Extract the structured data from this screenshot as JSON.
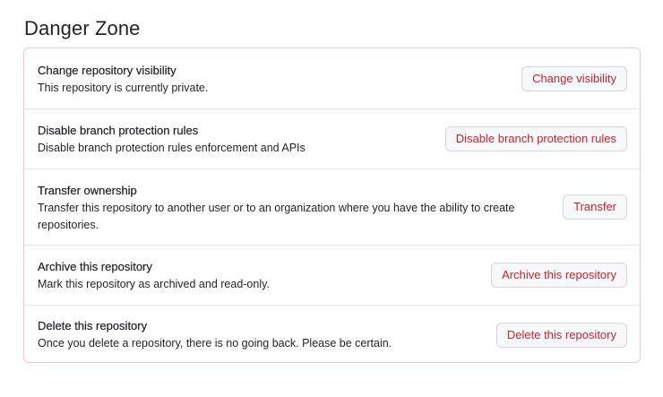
{
  "section": {
    "title": "Danger Zone"
  },
  "rows": [
    {
      "title": "Change repository visibility",
      "description": "This repository is currently private.",
      "button_label": "Change visibility"
    },
    {
      "title": "Disable branch protection rules",
      "description": "Disable branch protection rules enforcement and APIs",
      "button_label": "Disable branch protection rules"
    },
    {
      "title": "Transfer ownership",
      "description_line1": "Transfer this repository to another user or to an organization where you have the ability to create",
      "description_line2": "repositories.",
      "button_label": "Transfer"
    },
    {
      "title": "Archive this repository",
      "description": "Mark this repository as archived and read-only.",
      "button_label": "Archive this repository"
    },
    {
      "title": "Delete this repository",
      "description": "Once you delete a repository, there is no going back. Please be certain.",
      "button_label": "Delete this repository"
    }
  ],
  "colors": {
    "danger_text": "#cf222e",
    "danger_border": "#f2c6cf",
    "button_bg": "#f6f8fa",
    "divider": "#e6e8eb"
  }
}
